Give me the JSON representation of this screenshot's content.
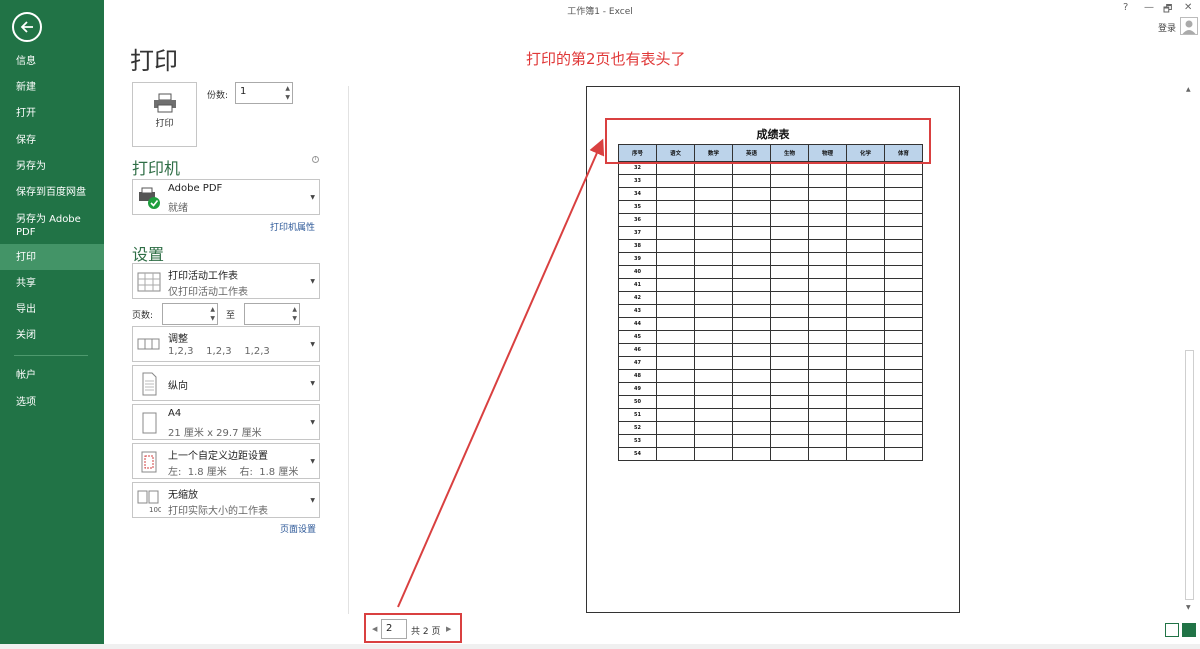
{
  "window": {
    "title": "工作簿1 - Excel",
    "help": "?",
    "minimize": "—",
    "restore": "🗗",
    "close": "✕",
    "login": "登录"
  },
  "nav": {
    "items": [
      "信息",
      "新建",
      "打开",
      "保存",
      "另存为",
      "保存到百度网盘",
      "另存为 Adobe PDF",
      "打印",
      "共享",
      "导出",
      "关闭",
      "帐户",
      "选项"
    ],
    "active": "打印"
  },
  "page_title": "打印",
  "annotation": "打印的第2页也有表头了",
  "print": {
    "button_label": "打印",
    "copies_label": "份数:",
    "copies_value": "1"
  },
  "printer": {
    "section": "打印机",
    "name": "Adobe PDF",
    "status": "就绪",
    "properties_link": "打印机属性"
  },
  "settings": {
    "section": "设置",
    "scope_main": "打印活动工作表",
    "scope_sub": "仅打印活动工作表",
    "pages_label": "页数:",
    "pages_to": "至",
    "collate_main": "调整",
    "collate_sub": "1,2,3    1,2,3    1,2,3",
    "orientation": "纵向",
    "paper_main": "A4",
    "paper_sub": "21 厘米 x 29.7 厘米",
    "margins_main": "上一个自定义边距设置",
    "margins_sub": "左:  1.8 厘米    右:  1.8 厘米",
    "scaling_main": "无缩放",
    "scaling_sub": "打印实际大小的工作表",
    "page_setup_link": "页面设置"
  },
  "preview": {
    "sheet_title": "成绩表",
    "headers": [
      "序号",
      "语文",
      "数学",
      "英语",
      "生物",
      "物理",
      "化学",
      "体育"
    ],
    "rows": [
      "32",
      "33",
      "34",
      "35",
      "36",
      "37",
      "38",
      "39",
      "40",
      "41",
      "42",
      "43",
      "44",
      "45",
      "46",
      "47",
      "48",
      "49",
      "50",
      "51",
      "52",
      "53",
      "54"
    ]
  },
  "pager": {
    "current": "2",
    "total": "共 2 页"
  },
  "colors": {
    "nav_bg": "#217346",
    "nav_active": "#439467",
    "accent_red": "#e03838",
    "header_fill": "#bcd3ea"
  }
}
